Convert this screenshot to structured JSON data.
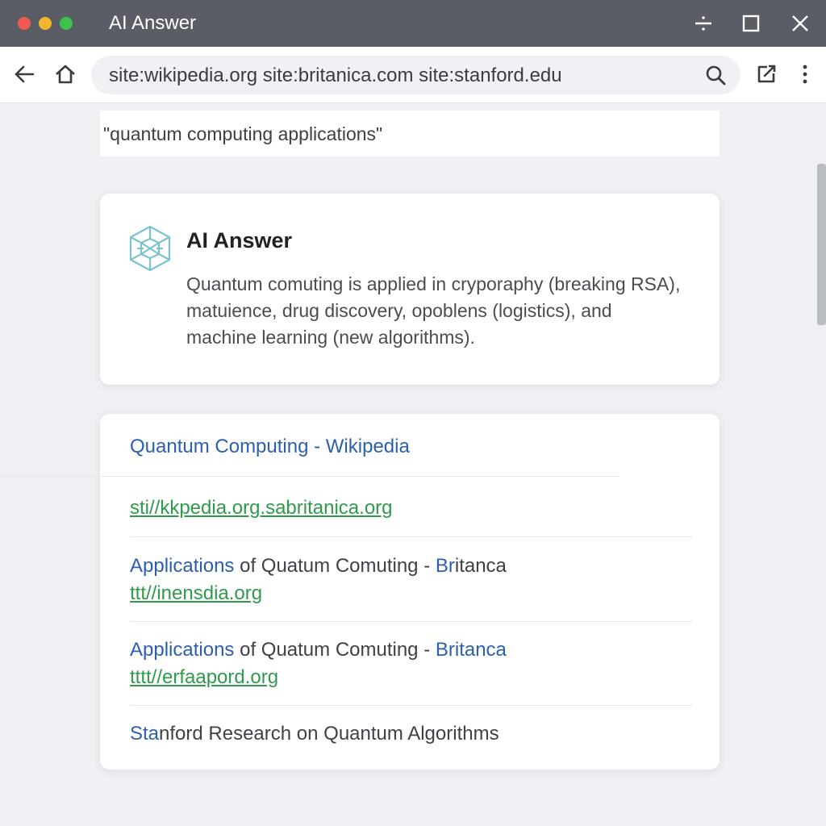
{
  "window": {
    "title": "AI Answer"
  },
  "toolbar": {
    "url": "site:wikipedia.org site:britanica.com site:stanford.edu"
  },
  "query": {
    "text": "\"quantum computing applications\""
  },
  "ai_answer": {
    "title": "AI Answer",
    "body": "Quantum comuting is applied in cryporaphy (breaking RSA), matuience, drug discovery, opoblens (logistics), and machine learning (new algorithms)."
  },
  "results": {
    "header": "Quantum Computing - Wikipedia",
    "link_1": "sti//kkpedia.org.sabritanica.org",
    "item_2": {
      "title_a": "Applications",
      "title_b": " of Quatum Comuting - ",
      "title_c": "Br",
      "title_d": "itanca",
      "link": "ttt//inensdia.org"
    },
    "item_3": {
      "title_a": "Applications",
      "title_b": " of Quatum Comuting - ",
      "title_c": "Britanca",
      "link": "tttt//erfaapord.org"
    },
    "item_4": {
      "title_a": "Sta",
      "title_b": "nford Research on Quantum Algorithms"
    }
  },
  "icons": {
    "back": "back-arrow-icon",
    "home": "home-icon",
    "search": "search-icon",
    "share": "open-external-icon",
    "menu": "more-vert-icon",
    "minimize": "minimize-icon",
    "maximize": "maximize-icon",
    "close": "close-icon",
    "ai_logo": "ai-logo-icon"
  },
  "colors": {
    "titlebar": "#5a5d66",
    "link_blue": "#2c5fad",
    "link_green": "#2f9a4c",
    "ai_logo": "#7cc3cf"
  }
}
